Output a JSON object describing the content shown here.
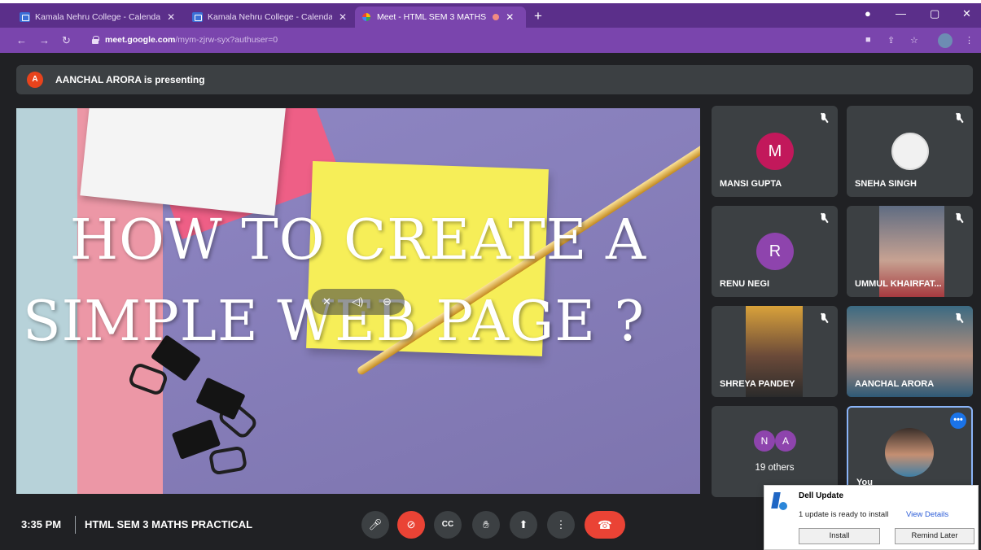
{
  "browser": {
    "tabs": [
      {
        "title": "Kamala Nehru College - Calenda",
        "icon": "calendar-icon"
      },
      {
        "title": "Kamala Nehru College - Calenda",
        "icon": "calendar-icon"
      },
      {
        "title": "Meet - HTML SEM 3 MATHS",
        "icon": "meet-icon"
      }
    ],
    "new_tab": "+",
    "url_main": "meet.google.com",
    "url_rest": "/mym-zjrw-syx?authuser=0"
  },
  "presenting_bar": {
    "avatar_letter": "A",
    "text": "AANCHAL ARORA is presenting"
  },
  "slide": {
    "line1": "HOW TO CREATE A",
    "line2": "SIMPLE WEB PAGE ?"
  },
  "participants": [
    {
      "name": "MANSI GUPTA",
      "letter": "M",
      "color": "#c2185b"
    },
    {
      "name": "SNEHA SINGH"
    },
    {
      "name": "RENU NEGI",
      "letter": "R",
      "color": "#8e44ad"
    },
    {
      "name": "UMMUL KHAIRFAT..."
    },
    {
      "name": "SHREYA PANDEY"
    },
    {
      "name": "AANCHAL ARORA"
    }
  ],
  "others": {
    "letters": [
      "N",
      "A"
    ],
    "label": "19 others"
  },
  "self_tile": {
    "name": "You"
  },
  "bottom_bar": {
    "time": "3:35 PM",
    "meeting": "HTML SEM 3 MATHS PRACTICAL"
  },
  "toast": {
    "title": "Dell Update",
    "body": "1 update is ready to install",
    "link": "View Details",
    "install": "Install",
    "remind": "Remind Later"
  },
  "colors": {
    "tab_bar": "#5b2f8a",
    "address_bar": "#7a45ad",
    "meet_bg": "#202124",
    "end_call": "#ea4335"
  }
}
